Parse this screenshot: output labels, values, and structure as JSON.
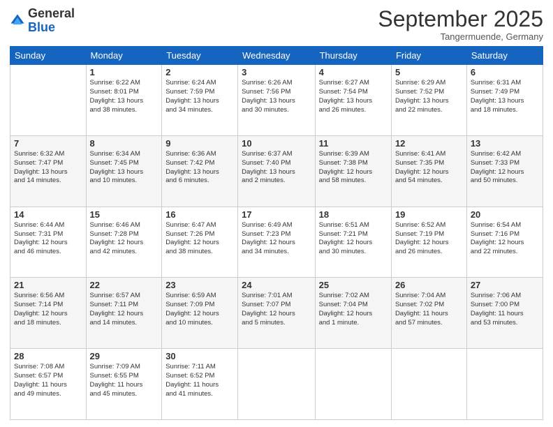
{
  "header": {
    "logo_general": "General",
    "logo_blue": "Blue",
    "month": "September 2025",
    "location": "Tangermuende, Germany"
  },
  "days_of_week": [
    "Sunday",
    "Monday",
    "Tuesday",
    "Wednesday",
    "Thursday",
    "Friday",
    "Saturday"
  ],
  "weeks": [
    [
      {
        "day": "",
        "info": ""
      },
      {
        "day": "1",
        "info": "Sunrise: 6:22 AM\nSunset: 8:01 PM\nDaylight: 13 hours\nand 38 minutes."
      },
      {
        "day": "2",
        "info": "Sunrise: 6:24 AM\nSunset: 7:59 PM\nDaylight: 13 hours\nand 34 minutes."
      },
      {
        "day": "3",
        "info": "Sunrise: 6:26 AM\nSunset: 7:56 PM\nDaylight: 13 hours\nand 30 minutes."
      },
      {
        "day": "4",
        "info": "Sunrise: 6:27 AM\nSunset: 7:54 PM\nDaylight: 13 hours\nand 26 minutes."
      },
      {
        "day": "5",
        "info": "Sunrise: 6:29 AM\nSunset: 7:52 PM\nDaylight: 13 hours\nand 22 minutes."
      },
      {
        "day": "6",
        "info": "Sunrise: 6:31 AM\nSunset: 7:49 PM\nDaylight: 13 hours\nand 18 minutes."
      }
    ],
    [
      {
        "day": "7",
        "info": "Sunrise: 6:32 AM\nSunset: 7:47 PM\nDaylight: 13 hours\nand 14 minutes."
      },
      {
        "day": "8",
        "info": "Sunrise: 6:34 AM\nSunset: 7:45 PM\nDaylight: 13 hours\nand 10 minutes."
      },
      {
        "day": "9",
        "info": "Sunrise: 6:36 AM\nSunset: 7:42 PM\nDaylight: 13 hours\nand 6 minutes."
      },
      {
        "day": "10",
        "info": "Sunrise: 6:37 AM\nSunset: 7:40 PM\nDaylight: 13 hours\nand 2 minutes."
      },
      {
        "day": "11",
        "info": "Sunrise: 6:39 AM\nSunset: 7:38 PM\nDaylight: 12 hours\nand 58 minutes."
      },
      {
        "day": "12",
        "info": "Sunrise: 6:41 AM\nSunset: 7:35 PM\nDaylight: 12 hours\nand 54 minutes."
      },
      {
        "day": "13",
        "info": "Sunrise: 6:42 AM\nSunset: 7:33 PM\nDaylight: 12 hours\nand 50 minutes."
      }
    ],
    [
      {
        "day": "14",
        "info": "Sunrise: 6:44 AM\nSunset: 7:31 PM\nDaylight: 12 hours\nand 46 minutes."
      },
      {
        "day": "15",
        "info": "Sunrise: 6:46 AM\nSunset: 7:28 PM\nDaylight: 12 hours\nand 42 minutes."
      },
      {
        "day": "16",
        "info": "Sunrise: 6:47 AM\nSunset: 7:26 PM\nDaylight: 12 hours\nand 38 minutes."
      },
      {
        "day": "17",
        "info": "Sunrise: 6:49 AM\nSunset: 7:23 PM\nDaylight: 12 hours\nand 34 minutes."
      },
      {
        "day": "18",
        "info": "Sunrise: 6:51 AM\nSunset: 7:21 PM\nDaylight: 12 hours\nand 30 minutes."
      },
      {
        "day": "19",
        "info": "Sunrise: 6:52 AM\nSunset: 7:19 PM\nDaylight: 12 hours\nand 26 minutes."
      },
      {
        "day": "20",
        "info": "Sunrise: 6:54 AM\nSunset: 7:16 PM\nDaylight: 12 hours\nand 22 minutes."
      }
    ],
    [
      {
        "day": "21",
        "info": "Sunrise: 6:56 AM\nSunset: 7:14 PM\nDaylight: 12 hours\nand 18 minutes."
      },
      {
        "day": "22",
        "info": "Sunrise: 6:57 AM\nSunset: 7:11 PM\nDaylight: 12 hours\nand 14 minutes."
      },
      {
        "day": "23",
        "info": "Sunrise: 6:59 AM\nSunset: 7:09 PM\nDaylight: 12 hours\nand 10 minutes."
      },
      {
        "day": "24",
        "info": "Sunrise: 7:01 AM\nSunset: 7:07 PM\nDaylight: 12 hours\nand 5 minutes."
      },
      {
        "day": "25",
        "info": "Sunrise: 7:02 AM\nSunset: 7:04 PM\nDaylight: 12 hours\nand 1 minute."
      },
      {
        "day": "26",
        "info": "Sunrise: 7:04 AM\nSunset: 7:02 PM\nDaylight: 11 hours\nand 57 minutes."
      },
      {
        "day": "27",
        "info": "Sunrise: 7:06 AM\nSunset: 7:00 PM\nDaylight: 11 hours\nand 53 minutes."
      }
    ],
    [
      {
        "day": "28",
        "info": "Sunrise: 7:08 AM\nSunset: 6:57 PM\nDaylight: 11 hours\nand 49 minutes."
      },
      {
        "day": "29",
        "info": "Sunrise: 7:09 AM\nSunset: 6:55 PM\nDaylight: 11 hours\nand 45 minutes."
      },
      {
        "day": "30",
        "info": "Sunrise: 7:11 AM\nSunset: 6:52 PM\nDaylight: 11 hours\nand 41 minutes."
      },
      {
        "day": "",
        "info": ""
      },
      {
        "day": "",
        "info": ""
      },
      {
        "day": "",
        "info": ""
      },
      {
        "day": "",
        "info": ""
      }
    ]
  ]
}
